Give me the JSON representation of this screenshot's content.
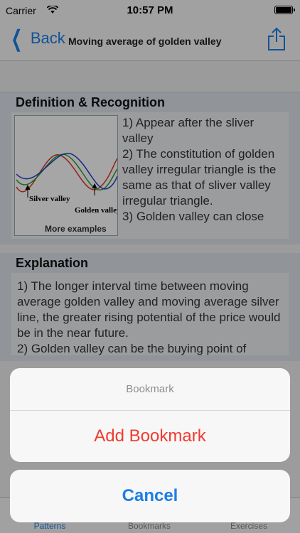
{
  "status": {
    "carrier": "Carrier",
    "time": "10:57 PM"
  },
  "nav": {
    "back_label": "Back",
    "title": "Moving average of golden valley"
  },
  "definition": {
    "title": "Definition & Recognition",
    "text": "1) Appear after the sliver valley\n2) The constitution of golden valley irregular triangle is the same as that of sliver valley irregular triangle.\n3) Golden valley can close",
    "chart_labels": {
      "silver": "Silver valley",
      "golden": "Golden valley"
    },
    "more_examples": "More examples"
  },
  "explanation": {
    "title": "Explanation",
    "text": "1)   The longer interval time between moving average golden valley and moving average silver line, the greater rising potential of the price would be in the near future.\n2)  Golden valley can be the buying point of"
  },
  "tabs": [
    {
      "label": "Patterns",
      "active": true
    },
    {
      "label": "Bookmarks",
      "active": false
    },
    {
      "label": "Exercises",
      "active": false
    }
  ],
  "action_sheet": {
    "title": "Bookmark",
    "add_label": "Add Bookmark",
    "cancel_label": "Cancel"
  },
  "colors": {
    "accent": "#1d7ee6",
    "destructive": "#f03b30",
    "line_red": "#e0332b",
    "line_green": "#2aa02a",
    "line_blue": "#1f3fd1"
  }
}
